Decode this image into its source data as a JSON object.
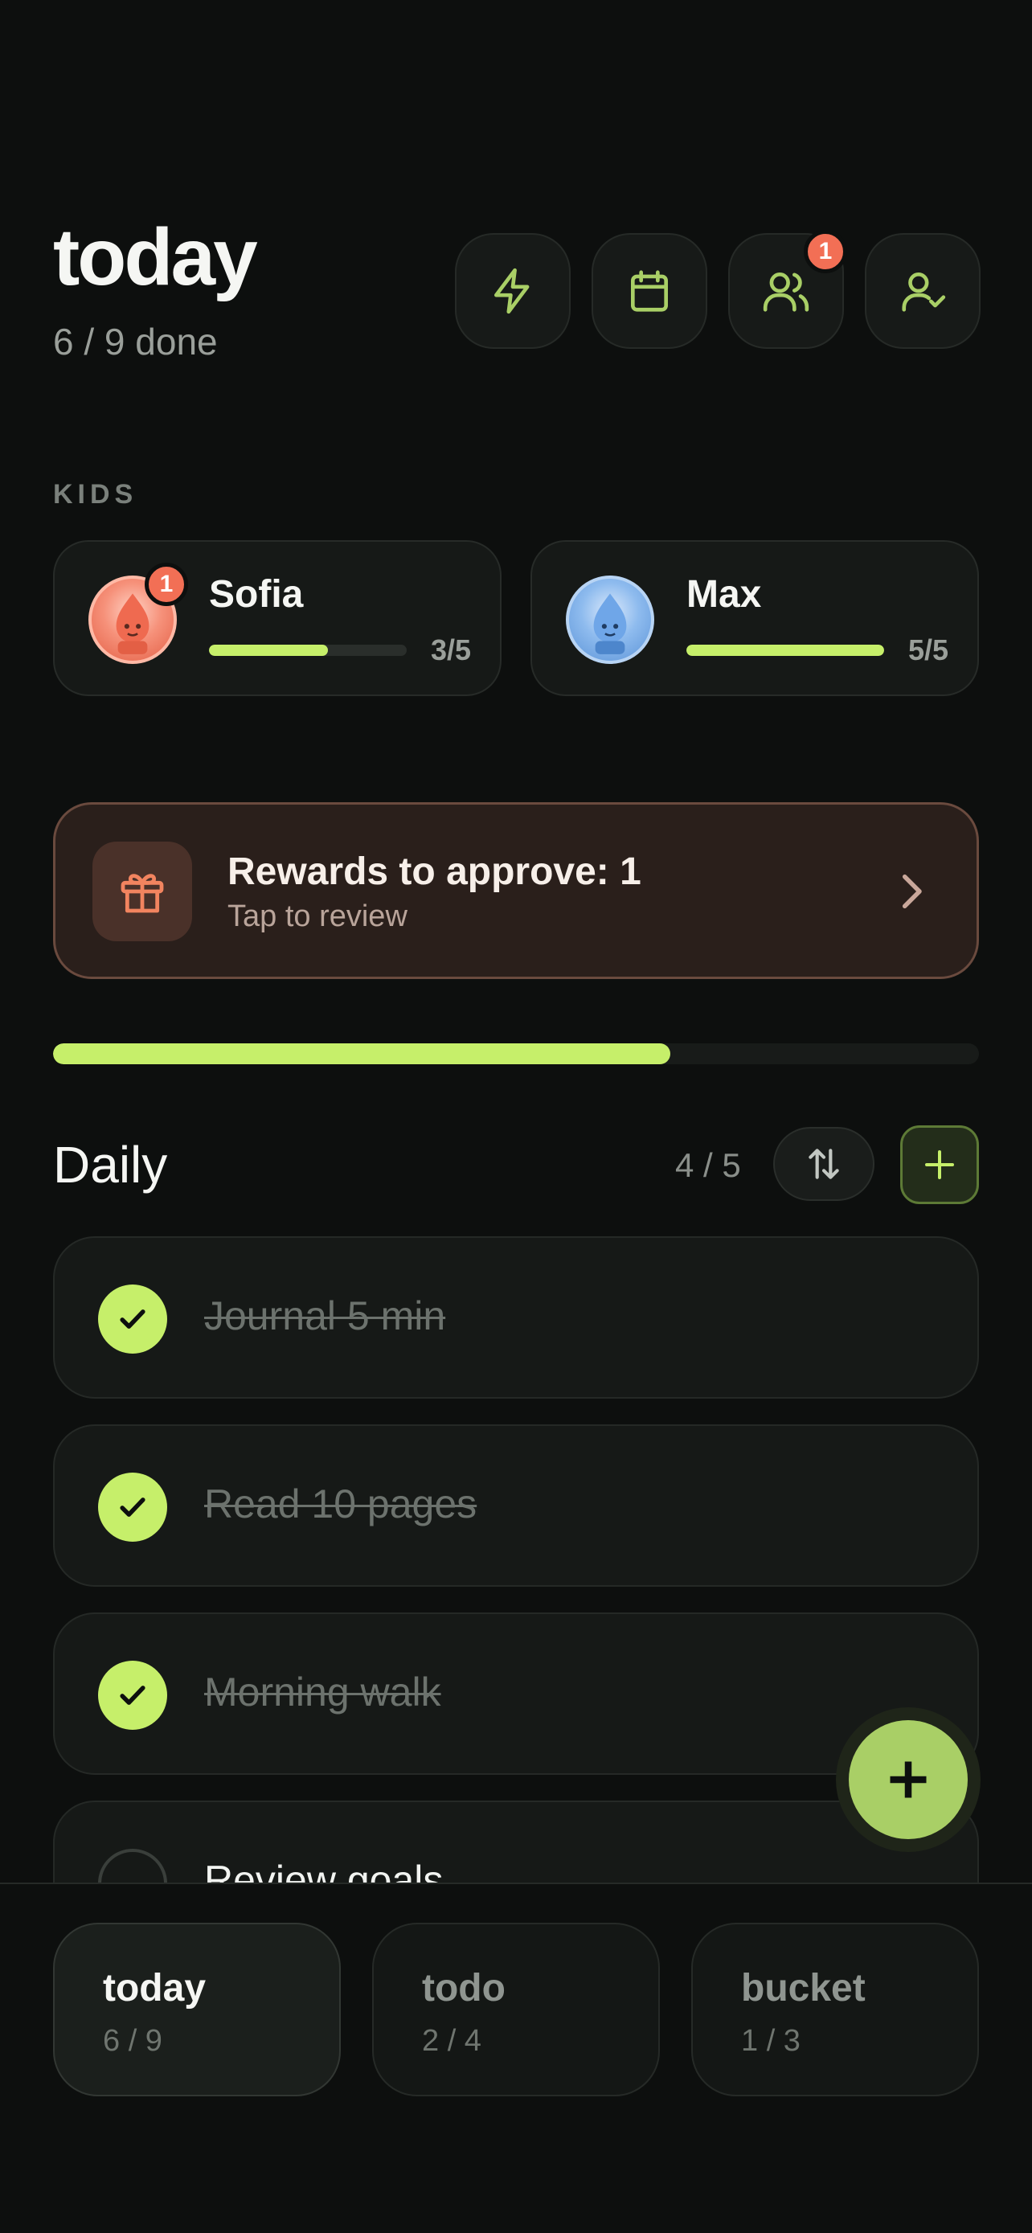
{
  "header": {
    "title": "today",
    "subtitle": "6 / 9 done"
  },
  "toolbar": {
    "buttons": [
      {
        "icon": "lightning-icon"
      },
      {
        "icon": "calendar-icon"
      },
      {
        "icon": "users-icon",
        "badge": "1"
      },
      {
        "icon": "user-check-icon"
      }
    ]
  },
  "kids": {
    "label": "KIDS",
    "items": [
      {
        "name": "Sofia",
        "count": "3/5",
        "progress": 0.6,
        "badge": "1",
        "avatar_color": "#f26f55"
      },
      {
        "name": "Max",
        "count": "5/5",
        "progress": 1.0,
        "avatar_color": "#6fa6e8"
      }
    ]
  },
  "rewards": {
    "title": "Rewards to approve: 1",
    "subtitle": "Tap to review"
  },
  "overall_progress": 0.667,
  "daily": {
    "title": "Daily",
    "count": "4 / 5",
    "tasks": [
      {
        "text": "Journal 5 min",
        "done": true
      },
      {
        "text": "Read 10 pages",
        "done": true
      },
      {
        "text": "Morning walk",
        "done": true
      },
      {
        "text": "Review goals",
        "done": false
      }
    ]
  },
  "nav": {
    "tabs": [
      {
        "label": "today",
        "count": "6 / 9",
        "active": true
      },
      {
        "label": "todo",
        "count": "2 / 4",
        "active": false
      },
      {
        "label": "bucket",
        "count": "1 / 3",
        "active": false
      }
    ]
  },
  "colors": {
    "accent": "#c6ef6a",
    "badge": "#f26f55",
    "background": "#0d0f0e"
  }
}
